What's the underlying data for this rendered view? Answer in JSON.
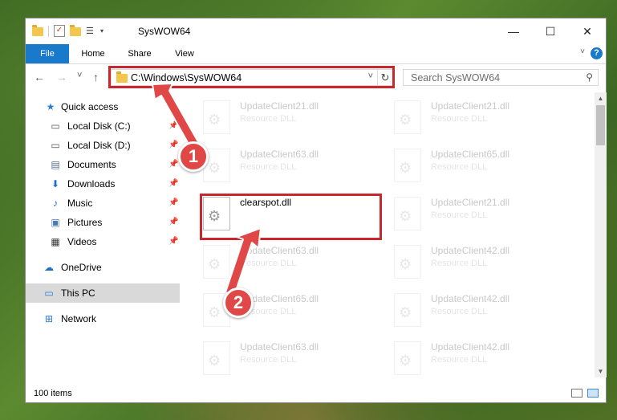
{
  "window": {
    "title": "SysWOW64",
    "minimize": "—",
    "maximize": "☐",
    "close": "✕"
  },
  "ribbon": {
    "tabs": [
      {
        "label": "File"
      },
      {
        "label": "Home"
      },
      {
        "label": "Share"
      },
      {
        "label": "View"
      }
    ],
    "help": "?"
  },
  "nav": {
    "back": "←",
    "forward": "→",
    "recent": "˅",
    "up": "↑",
    "address": "C:\\Windows\\SysWOW64",
    "address_dropdown": "˅",
    "refresh": "↻",
    "search_placeholder": "Search SysWOW64"
  },
  "sidebar": {
    "items": [
      {
        "label": "Quick access",
        "icon": "star-icon"
      },
      {
        "label": "Local Disk (C:)",
        "icon": "drive-icon",
        "pinned": true
      },
      {
        "label": "Local Disk (D:)",
        "icon": "drive-icon",
        "pinned": true
      },
      {
        "label": "Documents",
        "icon": "documents-icon",
        "pinned": true
      },
      {
        "label": "Downloads",
        "icon": "downloads-icon",
        "pinned": true
      },
      {
        "label": "Music",
        "icon": "music-icon",
        "pinned": true
      },
      {
        "label": "Pictures",
        "icon": "pictures-icon",
        "pinned": true
      },
      {
        "label": "Videos",
        "icon": "videos-icon",
        "pinned": true
      },
      {
        "label": "OneDrive",
        "icon": "cloud-icon"
      },
      {
        "label": "This PC",
        "icon": "computer-icon",
        "selected": true
      },
      {
        "label": "Network",
        "icon": "network-icon"
      }
    ]
  },
  "files": {
    "left": [
      {
        "name": "UpdateClient21.dll",
        "type": "Resource DLL"
      },
      {
        "name": "UpdateClient63.dll",
        "type": "Resource DLL"
      },
      {
        "name": "clearspot.dll",
        "type": ""
      },
      {
        "name": "UpdateClient63.dll",
        "type": "Resource DLL"
      },
      {
        "name": "UpdateClient65.dll",
        "type": "Resource DLL"
      },
      {
        "name": "UpdateClient63.dll",
        "type": "Resource DLL"
      }
    ],
    "right": [
      {
        "name": "UpdateClient21.dll",
        "type": "Resource DLL"
      },
      {
        "name": "UpdateClient65.dll",
        "type": "Resource DLL"
      },
      {
        "name": "UpdateClient21.dll",
        "type": "Resource DLL"
      },
      {
        "name": "UpdateClient42.dll",
        "type": "Resource DLL"
      },
      {
        "name": "UpdateClient42.dll",
        "type": "Resource DLL"
      },
      {
        "name": "UpdateClient42.dll",
        "type": "Resource DLL"
      }
    ]
  },
  "status": {
    "item_count": "100 items"
  },
  "annotations": {
    "step1": "1",
    "step2": "2",
    "color": "#c9272e"
  }
}
